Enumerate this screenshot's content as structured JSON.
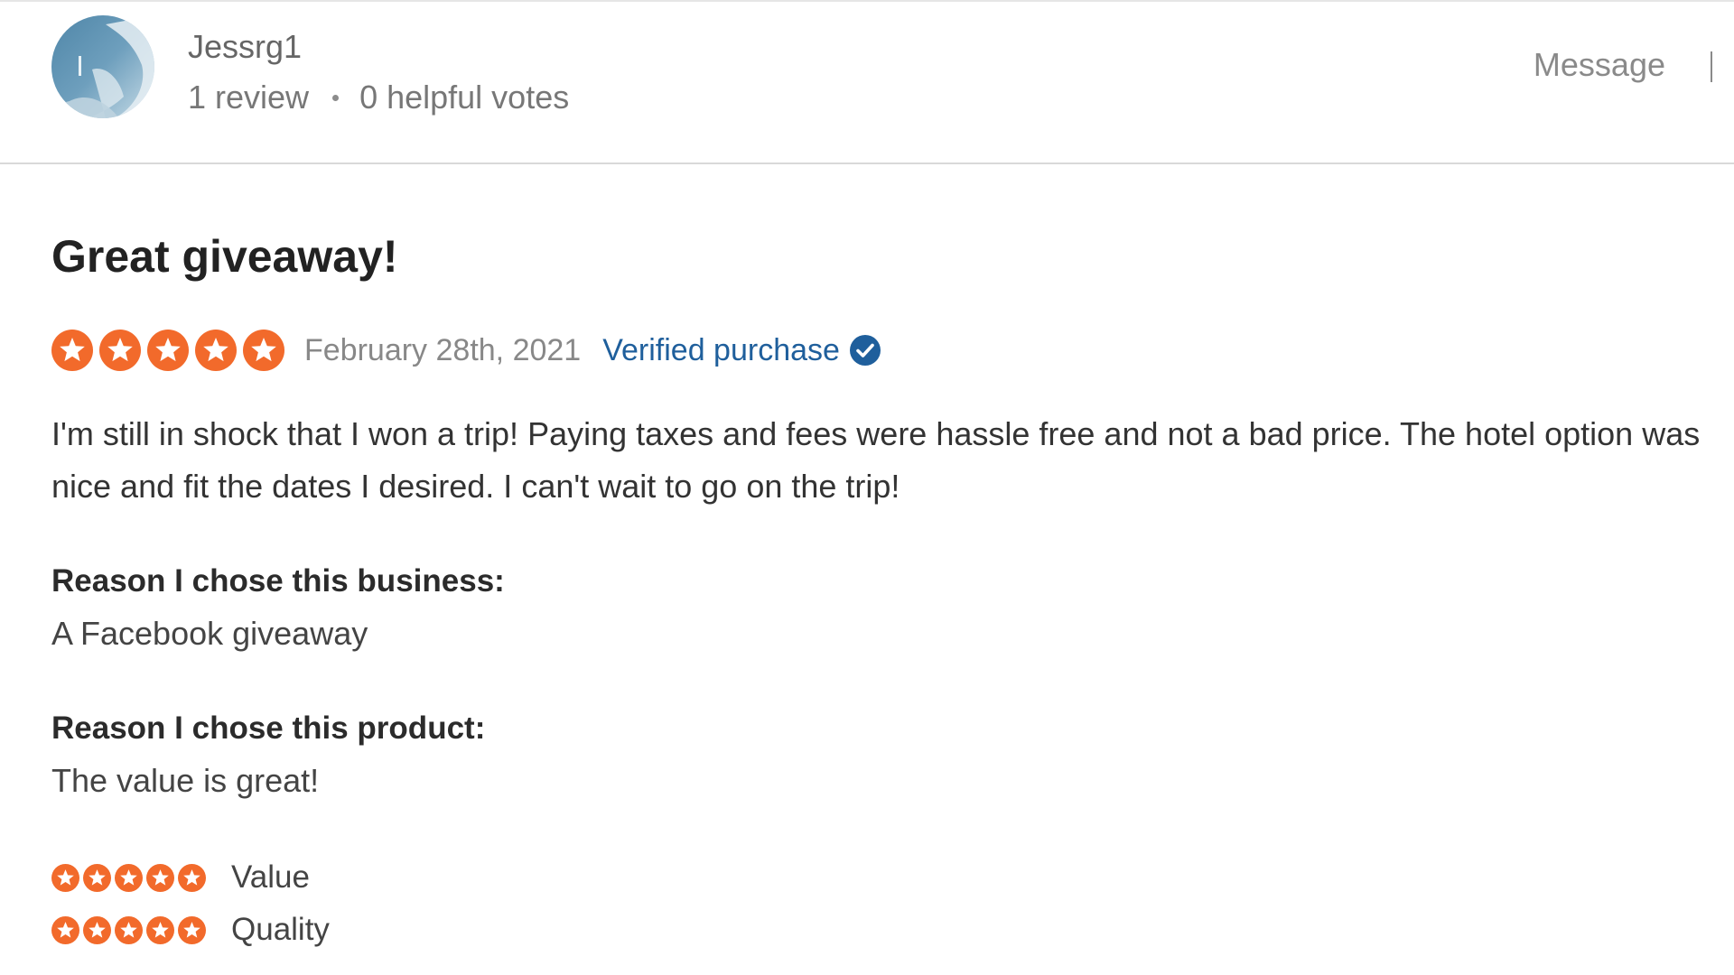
{
  "reviewer": {
    "name": "Jessrg1",
    "review_count": "1 review",
    "helpful_votes": "0 helpful votes",
    "message_label": "Message"
  },
  "review": {
    "title": "Great giveaway!",
    "rating": 5,
    "date": "February 28th, 2021",
    "verified_label": "Verified purchase",
    "text": "I'm still in shock that I won a trip! Paying taxes and fees were hassle free and not a bad price. The hotel option was nice and fit the dates I desired. I can't wait to go on the trip!",
    "reason_business_label": "Reason I chose this business:",
    "reason_business": "A Facebook giveaway",
    "reason_product_label": "Reason I chose this product:",
    "reason_product": "The value is great!",
    "sub_ratings": [
      {
        "label": "Value",
        "rating": 5
      },
      {
        "label": "Quality",
        "rating": 5
      }
    ]
  },
  "colors": {
    "star_orange": "#f26a2b",
    "verified_blue": "#1f5f9c"
  },
  "icons": {
    "star": "star-icon",
    "verified": "check-circle-icon"
  }
}
